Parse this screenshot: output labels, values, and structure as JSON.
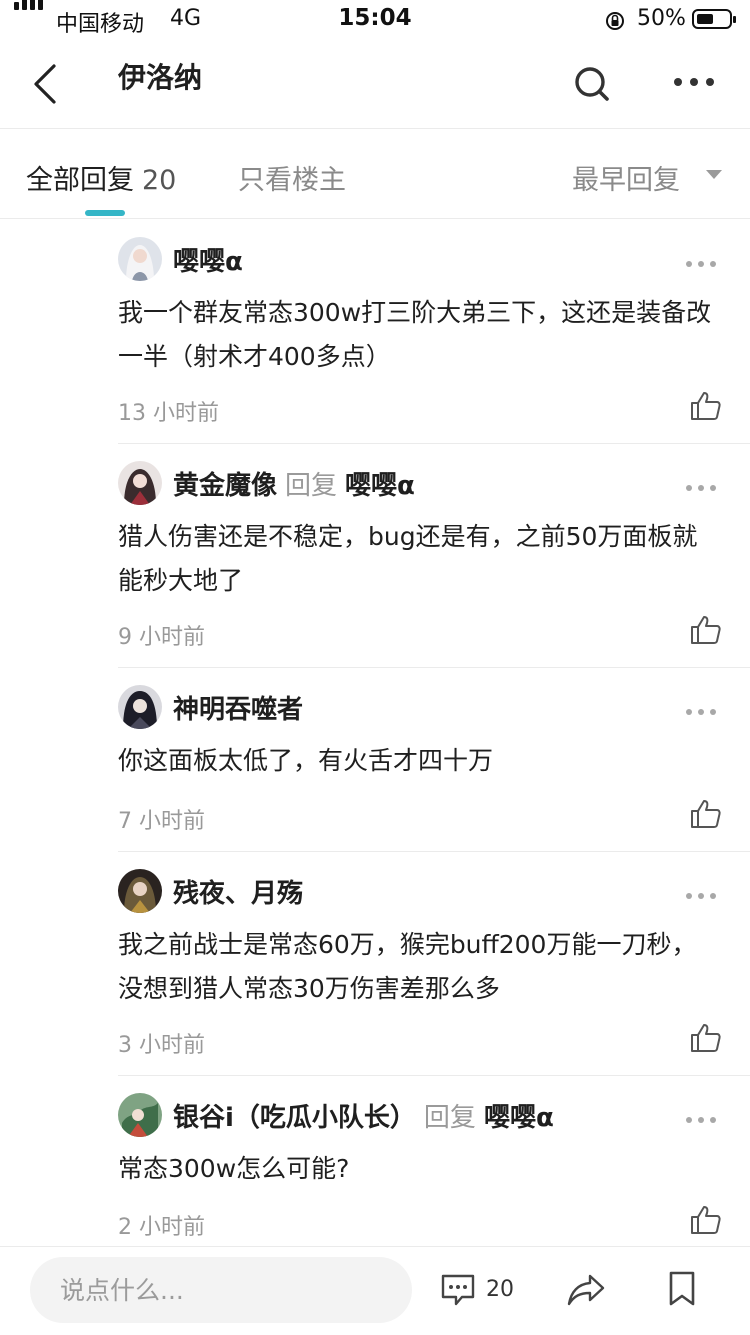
{
  "status_bar": {
    "carrier": "中国移动",
    "network": "4G",
    "time": "15:04",
    "battery": "50%"
  },
  "header": {
    "title": "伊洛纳"
  },
  "tabs": {
    "all_label": "全部回复",
    "all_count": "20",
    "op_only": "只看楼主",
    "sort": "最早回复"
  },
  "replies": [
    {
      "user": "嘤嘤α",
      "reply_word": "",
      "reply_to": "",
      "content": "我一个群友常态300w打三阶大弟三下，这还是装备改一半（射术才400多点）",
      "time": "13 小时前"
    },
    {
      "user": "黄金魔像",
      "reply_word": "回复",
      "reply_to": "嘤嘤α",
      "content": "猎人伤害还是不稳定，bug还是有，之前50万面板就能秒大地了",
      "time": "9 小时前"
    },
    {
      "user": "神明吞噬者",
      "reply_word": "",
      "reply_to": "",
      "content": "你这面板太低了，有火舌才四十万",
      "time": "7 小时前"
    },
    {
      "user": "残夜、月殇",
      "reply_word": "",
      "reply_to": "",
      "content": "我之前战士是常态60万，猴完buff200万能一刀秒，没想到猎人常态30万伤害差那么多",
      "time": "3 小时前"
    },
    {
      "user": "银谷i（吃瓜小队长）",
      "reply_word": "回复",
      "reply_to": "嘤嘤α",
      "content": "常态300w怎么可能?",
      "time": "2 小时前"
    }
  ],
  "bottom_bar": {
    "input_placeholder": "说点什么...",
    "comment_count": "20"
  },
  "colors": {
    "accent": "#35b6c7",
    "text": "#1f1f1f",
    "muted": "#999999",
    "divider": "#ebebeb"
  }
}
